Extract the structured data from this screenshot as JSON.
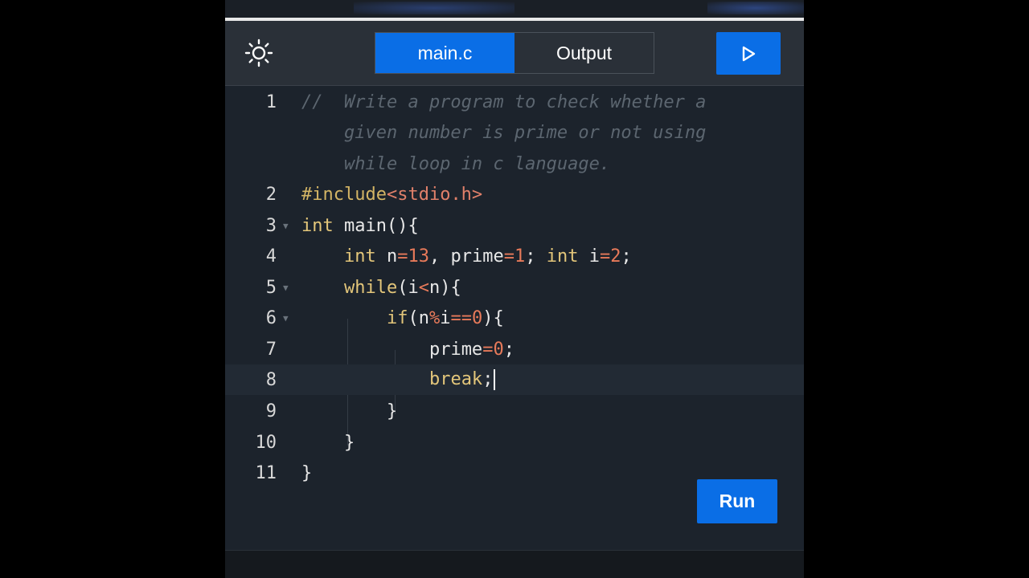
{
  "header": {
    "theme_icon": "sun-icon",
    "tabs": [
      {
        "label": "main.c",
        "active": true
      },
      {
        "label": "Output",
        "active": false
      }
    ],
    "run_icon": "play-icon"
  },
  "editor": {
    "language": "c",
    "active_line": 8,
    "lines": [
      {
        "num": "1",
        "comment": [
          "//  Write a program to check whether a",
          "    given number is prime or not using",
          "    while loop in c language."
        ]
      },
      {
        "num": "2",
        "text": "#include<stdio.h>"
      },
      {
        "num": "3",
        "text": "int main(){"
      },
      {
        "num": "4",
        "text": "    int n=13, prime=1; int i=2;"
      },
      {
        "num": "5",
        "text": "    while(i<n){"
      },
      {
        "num": "6",
        "text": "        if(n%i==0){"
      },
      {
        "num": "7",
        "text": "            prime=0;"
      },
      {
        "num": "8",
        "text": "            break;"
      },
      {
        "num": "9",
        "text": "        }"
      },
      {
        "num": "10",
        "text": "    }"
      },
      {
        "num": "11",
        "text": "}"
      }
    ]
  },
  "run_button": {
    "label": "Run"
  },
  "colors": {
    "accent": "#0a6ee6",
    "background": "#1c232c",
    "header": "#2a3038"
  }
}
